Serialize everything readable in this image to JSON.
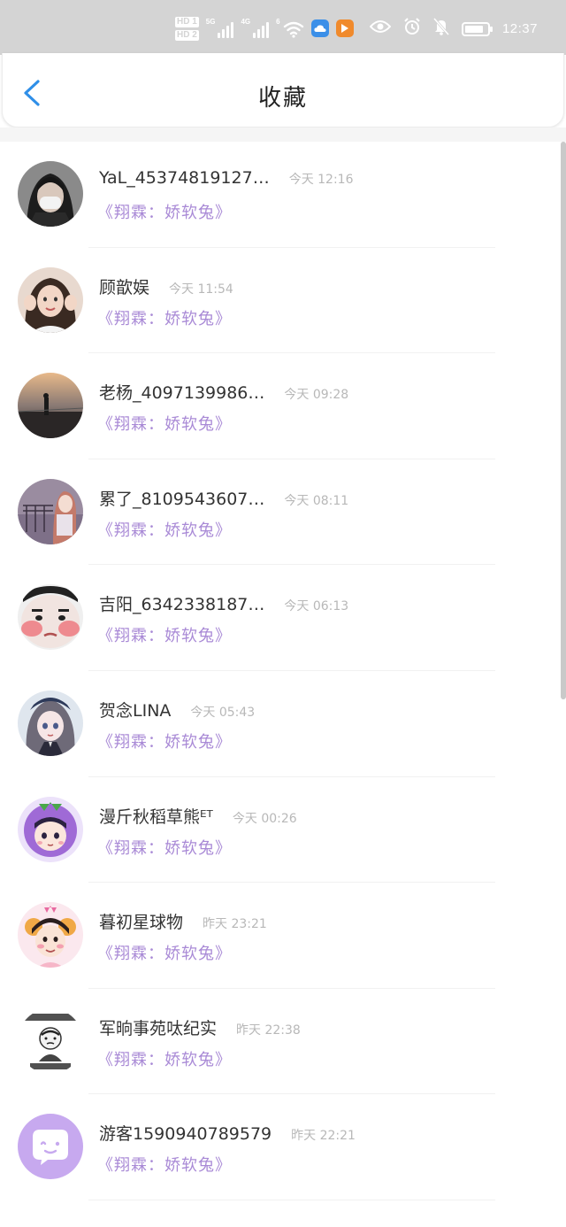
{
  "status_bar": {
    "hd1": "HD 1",
    "hd2": "HD 2",
    "sig1_tag": "5G",
    "sig2_tag": "4G",
    "wifi_tag": "6",
    "time": "12:37",
    "battery_level_pct": 85,
    "icons": [
      "wifi-icon",
      "cloud-app-icon",
      "video-app-icon",
      "eye-icon",
      "alarm-icon",
      "mute-bell-icon",
      "battery-icon"
    ]
  },
  "header": {
    "title": "收藏",
    "back_icon": "chevron-left-icon"
  },
  "favorites": [
    {
      "name": "YaL_45374819127…",
      "time": "今天 12:16",
      "subtitle": "《翔霖：娇软兔》",
      "avatar_icon": "avatar-masked-girl"
    },
    {
      "name": "顾歆娱",
      "time": "今天 11:54",
      "subtitle": "《翔霖：娇软兔》",
      "avatar_icon": "avatar-girl-pose"
    },
    {
      "name": "老杨_4097139986…",
      "time": "今天 09:28",
      "subtitle": "《翔霖：娇软兔》",
      "avatar_icon": "avatar-sunset"
    },
    {
      "name": "累了_8109543607…",
      "time": "今天 08:11",
      "subtitle": "《翔霖：娇软兔》",
      "avatar_icon": "avatar-anime-balcony"
    },
    {
      "name": "吉阳_6342338187…",
      "time": "今天 06:13",
      "subtitle": "《翔霖：娇软兔》",
      "avatar_icon": "avatar-blush-face"
    },
    {
      "name": "贺念LINA",
      "time": "今天 05:43",
      "subtitle": "《翔霖：娇软兔》",
      "avatar_icon": "avatar-anime-girl"
    },
    {
      "name": "漫斤秋稻草熊ᴱᵀ",
      "time": "今天 00:26",
      "subtitle": "《翔霖：娇软兔》",
      "avatar_icon": "avatar-eggplant-boy"
    },
    {
      "name": "暮初星球物",
      "time": "昨天 23:21",
      "subtitle": "《翔霖：娇软兔》",
      "avatar_icon": "avatar-lion-boy"
    },
    {
      "name": "军晌事苑呔纪实",
      "time": "昨天 22:38",
      "subtitle": "《翔霖：娇软兔》",
      "avatar_icon": "avatar-meme"
    },
    {
      "name": "游客1590940789579",
      "time": "昨天 22:21",
      "subtitle": "《翔霖：娇软兔》",
      "avatar_icon": "avatar-default-chat"
    }
  ],
  "colors": {
    "subtitle": "#a98ad6",
    "back_arrow": "#2f8fe8",
    "status_bar_bg": "#d4d4d4"
  }
}
